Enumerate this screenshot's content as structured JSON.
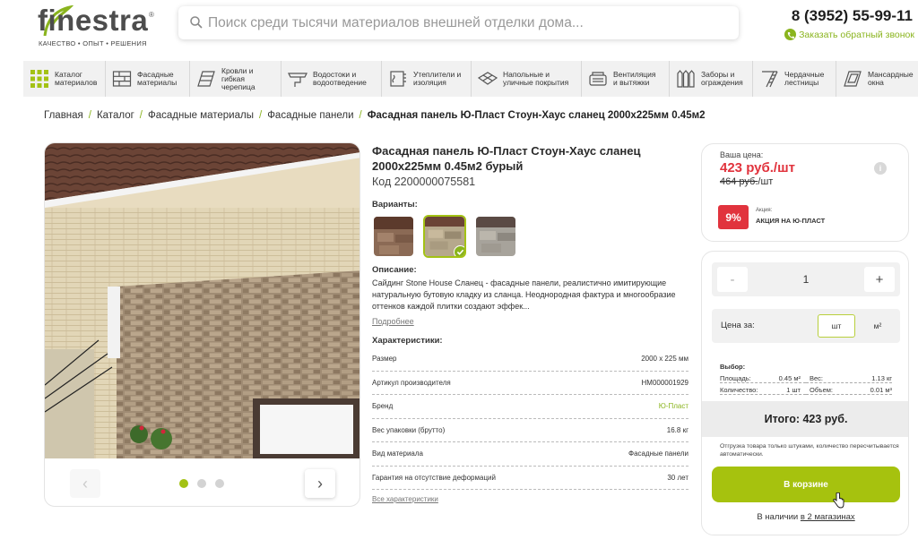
{
  "brand": {
    "name": "finestra",
    "tagline": "КАЧЕСТВО • ОПЫТ • РЕШЕНИЯ",
    "accent": "#8ab41e",
    "sale_color": "#e1333d"
  },
  "search": {
    "placeholder": "Поиск среди тысячи материалов внешней отделки дома..."
  },
  "contact": {
    "phone": "8 (3952) 55-99-11",
    "callback_label": "Заказать обратный звонок"
  },
  "categories": [
    {
      "label": "Каталог\nматериалов",
      "icon": "grid-icon"
    },
    {
      "label": "Фасадные\nматериалы",
      "icon": "facade-icon"
    },
    {
      "label": "Кровли и\nгибкая\nчерепица",
      "icon": "roof-icon"
    },
    {
      "label": "Водостоки и\nводоотведение",
      "icon": "gutter-icon"
    },
    {
      "label": "Утеплители и\nизоляция",
      "icon": "insulation-icon"
    },
    {
      "label": "Напольные и\nуличные покрытия",
      "icon": "floor-icon"
    },
    {
      "label": "Вентиляция\nи вытяжки",
      "icon": "ventilation-icon"
    },
    {
      "label": "Заборы и\nограждения",
      "icon": "fence-icon"
    },
    {
      "label": "Чердачные\nлестницы",
      "icon": "ladder-icon"
    },
    {
      "label": "Мансардные\nокна",
      "icon": "window-icon"
    }
  ],
  "breadcrumb": {
    "items": [
      "Главная",
      "Каталог",
      "Фасадные материалы",
      "Фасадные панели"
    ],
    "current": "Фасадная панель Ю-Пласт Стоун-Хаус сланец 2000х225мм 0.45м2"
  },
  "gallery": {
    "active_slide": 1,
    "slide_count": 3
  },
  "product": {
    "title": "Фасадная панель Ю-Пласт Стоун-Хаус сланец 2000х225мм 0.45м2 бурый",
    "code": "Код 2200000075581",
    "variants_label": "Варианты:",
    "description_label": "Описание:",
    "description": "Сайдинг Stone House Сланец - фасадные панели, реалистично имитирующие натуральную бутовую кладку из сланца. Неоднородная фактура и многообразие оттенков каждой плитки создают эффек...",
    "more_link": "Подробнее",
    "specs_label": "Характеристики:",
    "specs": [
      {
        "name": "Размер",
        "value": "2000 x 225 мм"
      },
      {
        "name": "Артикул производителя",
        "value": "HM000001929"
      },
      {
        "name": "Бренд",
        "value": "Ю-Пласт"
      },
      {
        "name": "Вес упаковки (брутто)",
        "value": "16.8 кг"
      },
      {
        "name": "Вид материала",
        "value": "Фасадные панели"
      },
      {
        "name": "Гарантия на отсутствие деформаций",
        "value": "30 лет"
      }
    ],
    "all_specs_link": "Все характеристики"
  },
  "pricing": {
    "your_price_label": "Ваша цена:",
    "current_price": "423 руб./шт",
    "old_price": "464 руб.",
    "old_price_unit": "/шт",
    "info_glyph": "i",
    "discount": "9%",
    "promo_caption": "Акция:",
    "promo_name": "АКЦИЯ НА Ю-ПЛАСТ"
  },
  "order": {
    "minus": "-",
    "plus": "+",
    "quantity": "1",
    "price_for_label": "Цена за:",
    "unit_piece": "шт",
    "unit_area": "м²",
    "selection_label": "Выбор:",
    "area_label": "Площадь:",
    "area_value": "0.45 м²",
    "weight_label": "Вес:",
    "weight_value": "1.13 кг",
    "count_label": "Количество:",
    "count_value": "1 шт",
    "volume_label": "Объем:",
    "volume_value": "0.01 м³",
    "total": "Итого: 423 руб.",
    "shipping_note": "Отгрузка товара только штуками, количество пересчитывается автоматически.",
    "cart_button": "В корзине",
    "stock_prefix": "В наличии ",
    "stock_link": "в 2 магазинах"
  }
}
